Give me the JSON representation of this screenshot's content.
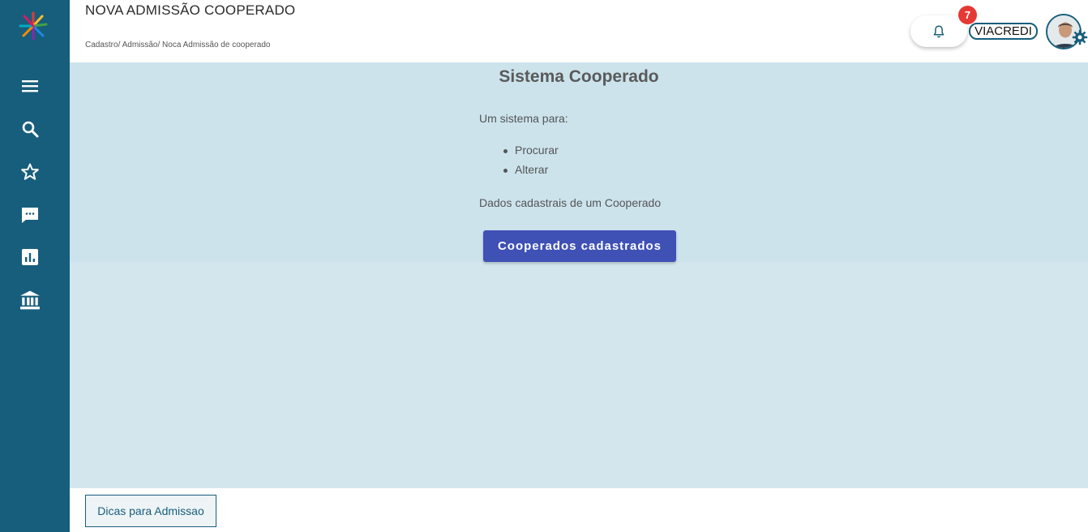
{
  "header": {
    "title": "NOVA ADMISSÃO COOPERADO",
    "breadcrumb": "Cadastro/ Admissão/ Noca Admissão de cooperado",
    "notification_count": "7",
    "cooperative": "VIACREDI"
  },
  "sidebar": {
    "items": [
      {
        "icon": "menu-icon"
      },
      {
        "icon": "search-icon"
      },
      {
        "icon": "star-icon"
      },
      {
        "icon": "chat-icon"
      },
      {
        "icon": "chart-icon"
      },
      {
        "icon": "bank-icon"
      }
    ]
  },
  "main": {
    "title": "Sistema Cooperado",
    "intro": "Um sistema para:",
    "features": [
      "Procurar",
      "Alterar"
    ],
    "description": "Dados cadastrais de um Cooperado",
    "button_label": "Cooperados cadastrados"
  },
  "footer": {
    "tips_label": "Dicas para Admissao"
  },
  "colors": {
    "sidebar": "#175e7c",
    "main_bg": "#d3e6ed",
    "panel_bg": "#cce3ec",
    "primary": "#3f51b5",
    "badge": "#e53935"
  }
}
